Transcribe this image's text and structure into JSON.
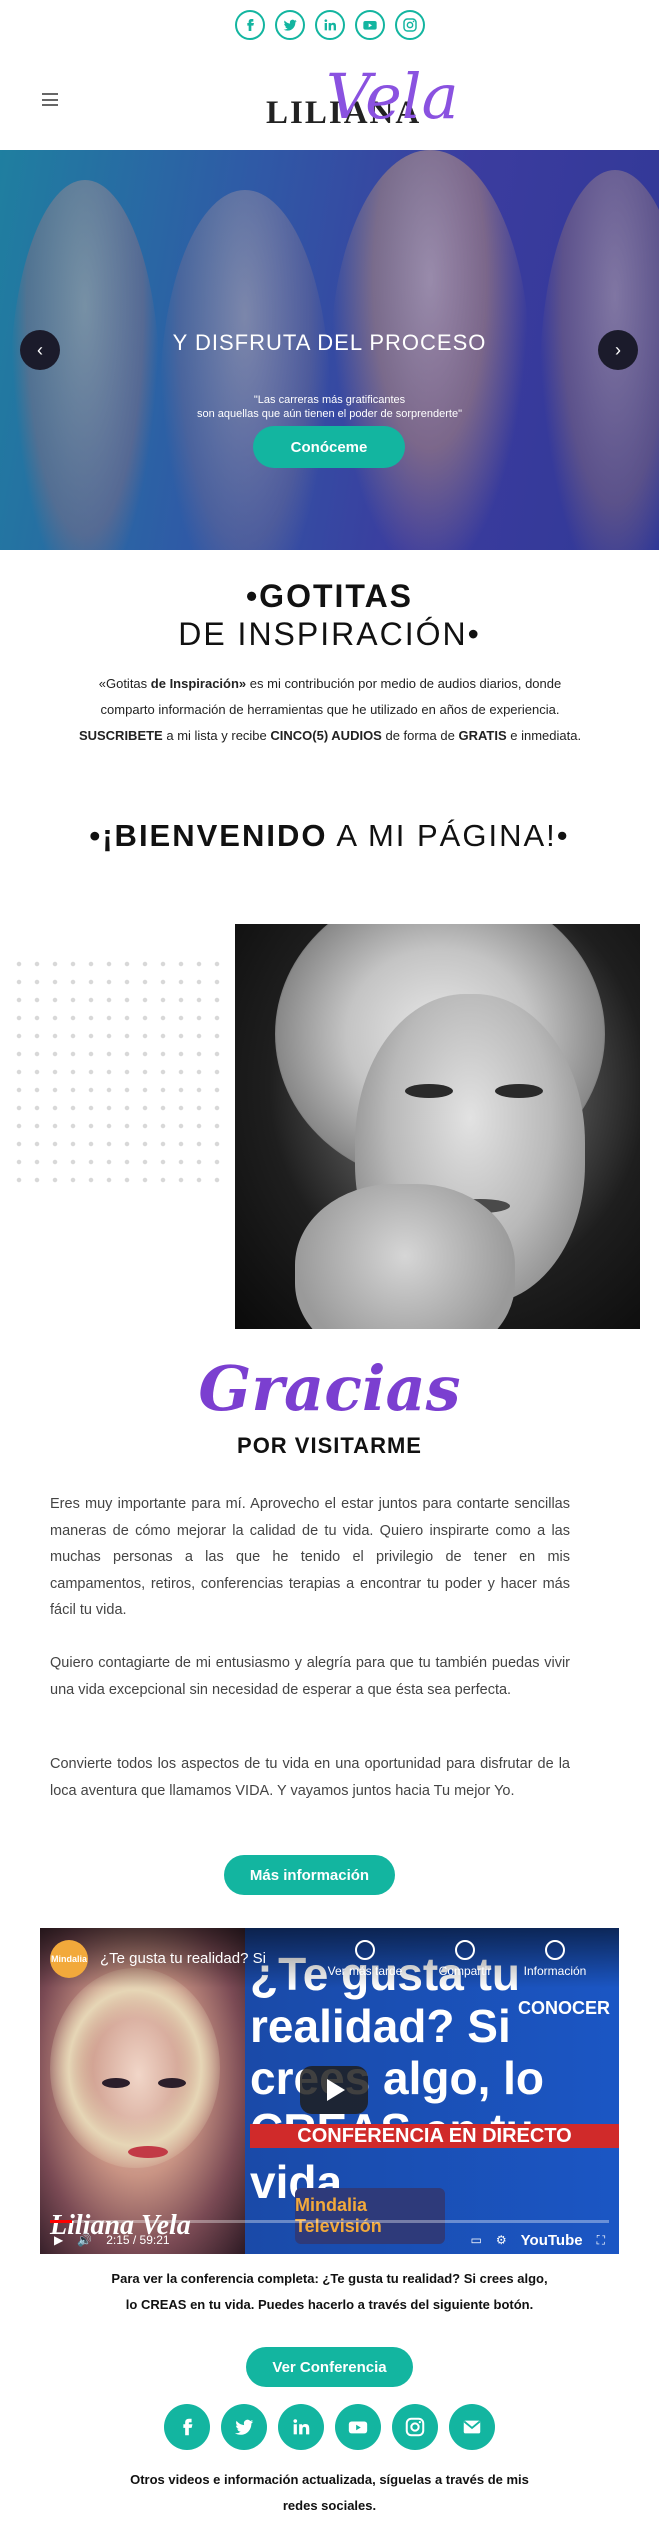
{
  "social_top": [
    {
      "name": "facebook-icon",
      "glyph": "f"
    },
    {
      "name": "twitter-icon",
      "glyph": "t"
    },
    {
      "name": "linkedin-icon",
      "glyph": "in"
    },
    {
      "name": "youtube-icon",
      "glyph": "yt"
    },
    {
      "name": "instagram-icon",
      "glyph": "ig"
    }
  ],
  "header": {
    "logo_part1": "LILIANA",
    "logo_part2": "Vela"
  },
  "hero": {
    "title": "Y DISFRUTA DEL PROCESO",
    "quote_line1": "\"Las carreras más gratificantes",
    "quote_line2": "son aquellas que aún tienen el poder de sorprenderte\"",
    "button_label": "Conóceme",
    "prev_label": "‹",
    "next_label": "›"
  },
  "gotitas": {
    "title_bold": "•GOTITAS",
    "title_light": "DE INSPIRACIÓN•",
    "p1_a": "«Gotitas ",
    "p1_b": "de Inspiración»",
    "p1_c": " es mi contribución por medio de audios diarios, donde",
    "p2": "comparto información de herramientas que he utilizado en años de experiencia.",
    "p3_a": "SUSCRIBETE",
    "p3_b": " a mi lista y recibe ",
    "p3_c": "CINCO(5) AUDIOS",
    "p3_d": " de forma de ",
    "p3_e": "GRATIS",
    "p3_f": " e inmediata."
  },
  "welcome": {
    "bold": "•¡BIENVENIDO",
    "rest": " A MI PÁGINA!•"
  },
  "gracias": {
    "script": "Gracias",
    "sub": "POR VISITARME",
    "para1": "Eres muy importante para mí. Aprovecho el estar juntos para contarte sencillas maneras de cómo mejorar la calidad de tu vida. Quiero inspirarte como a las muchas personas a las que he tenido el privilegio de tener en mis campamentos, retiros, conferencias terapias a encontrar tu poder y hacer más fácil tu vida.",
    "para2": "Quiero contagiarte de mi entusiasmo y alegría para que tu también puedas vivir una vida excepcional sin necesidad de esperar a que ésta sea perfecta.",
    "para3": "Convierte todos los aspectos de tu vida en una oportunidad para disfrutar de la loca aventura que llamamos VIDA. Y vayamos juntos hacia Tu mejor Yo.",
    "button_label": "Más información"
  },
  "video": {
    "channel_badge": "Mindalia",
    "title": "¿Te gusta tu realidad? Si",
    "watch_later": "Ver más tarde",
    "share": "Compartir",
    "info": "Información",
    "overlay_text": "¿Te gusta tu realidad? Si crees algo, lo CREAS en tu vida",
    "conocer": "CONOCER",
    "band": "CONFERENCIA EN DIRECTO",
    "mindalia": "Mindalia Televisión",
    "name": "Liliana Vela",
    "time": "2:15 / 59:21",
    "progress": 0.04,
    "yt_label": "YouTube"
  },
  "conference": {
    "note_line1": "Para ver la conferencia completa: ¿Te gusta tu realidad? Si crees algo,",
    "note_line2": "lo CREAS en tu vida. Puedes hacerlo a través del siguiente botón.",
    "button_label": "Ver Conferencia"
  },
  "social_bottom": [
    {
      "name": "facebook-icon",
      "glyph": "f"
    },
    {
      "name": "twitter-icon",
      "glyph": "t"
    },
    {
      "name": "linkedin-icon",
      "glyph": "in"
    },
    {
      "name": "youtube-icon",
      "glyph": "yt"
    },
    {
      "name": "instagram-icon",
      "glyph": "ig"
    },
    {
      "name": "email-icon",
      "glyph": "@"
    }
  ],
  "footer": {
    "line1": "Otros videos e información actualizada, síguelas a través de mis",
    "line2": "redes sociales."
  },
  "colors": {
    "accent": "#13b5a0",
    "purple": "#7b3fd0"
  }
}
